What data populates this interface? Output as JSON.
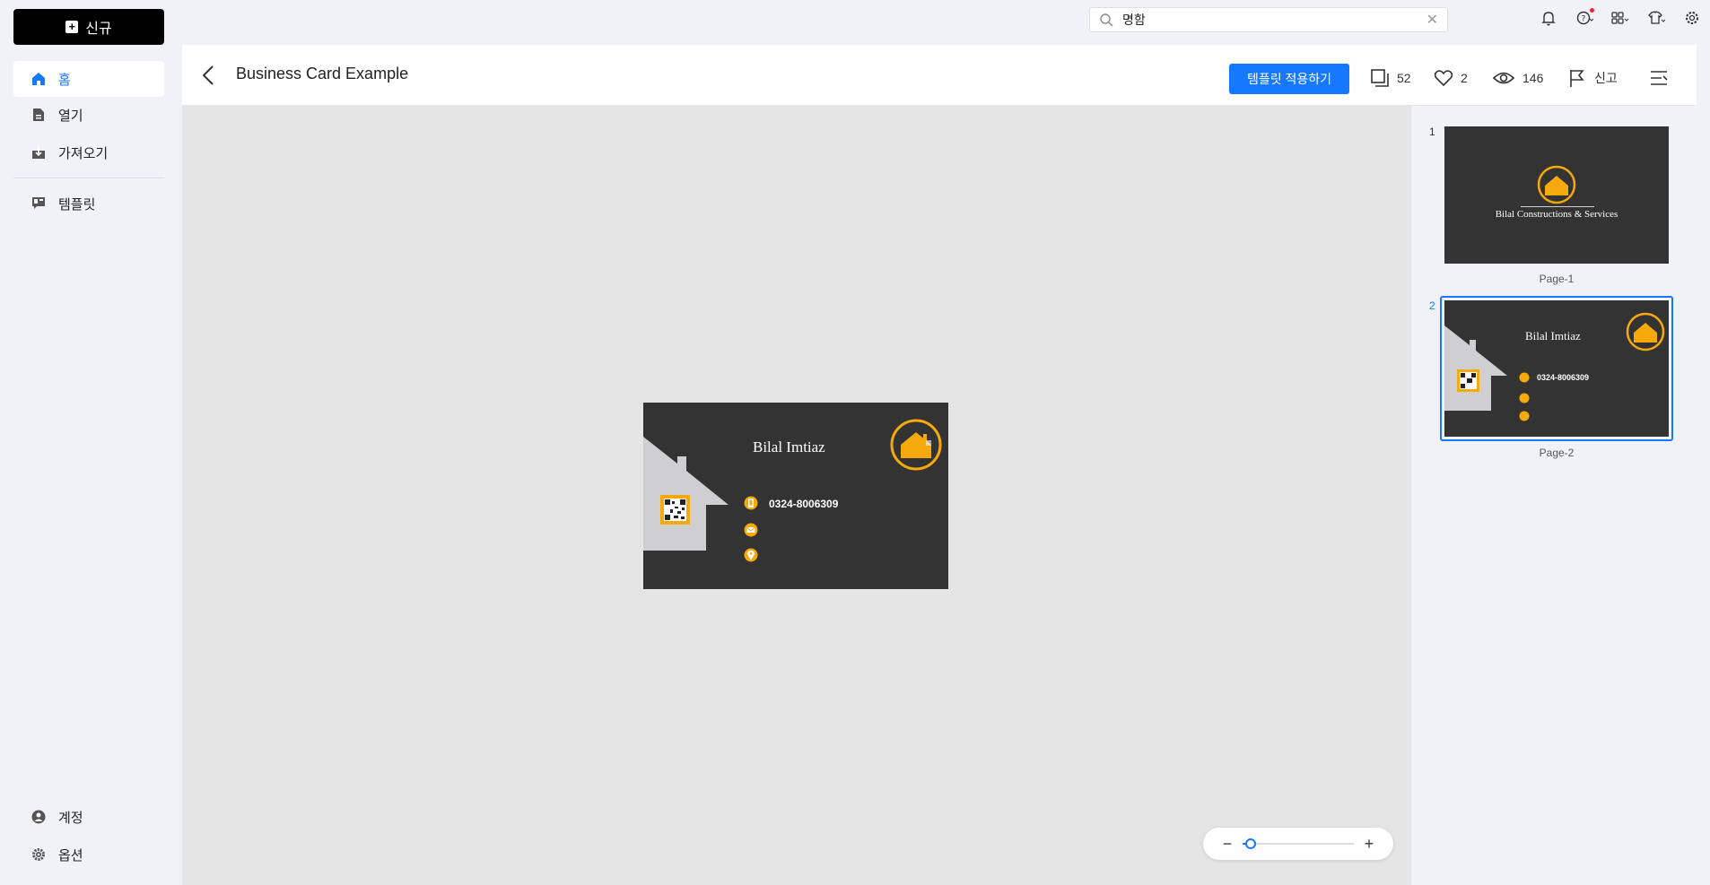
{
  "sidebar": {
    "new_label": "신규",
    "items": [
      {
        "label": "홈",
        "icon": "home-icon"
      },
      {
        "label": "열기",
        "icon": "document-icon"
      },
      {
        "label": "가져오기",
        "icon": "import-icon"
      },
      {
        "label": "템플릿",
        "icon": "template-icon"
      }
    ],
    "bottom": [
      {
        "label": "계정",
        "icon": "account-icon"
      },
      {
        "label": "옵션",
        "icon": "settings-icon"
      }
    ]
  },
  "search": {
    "value": "명함"
  },
  "header": {
    "title": "Business Card Example",
    "apply_label": "템플릿 적용하기",
    "copies": "52",
    "likes": "2",
    "views": "146",
    "report_label": "신고"
  },
  "card": {
    "name": "Bilal Imtiaz",
    "phone": "0324-8006309"
  },
  "pages": [
    {
      "number": "1",
      "label": "Page-1",
      "company": "Bilal Constructions & Services"
    },
    {
      "number": "2",
      "label": "Page-2",
      "name": "Bilal Imtiaz",
      "phone": "0324-8006309"
    }
  ],
  "colors": {
    "accent": "#1677ff",
    "card_bg": "#333333",
    "gold": "#f5a90a",
    "house": "#cfcfd1"
  },
  "zoom": {
    "level": 0.07
  }
}
